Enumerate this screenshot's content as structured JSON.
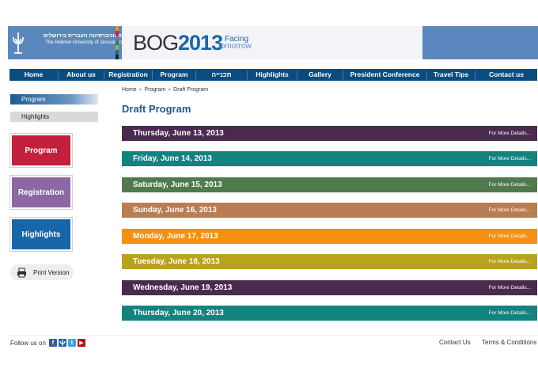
{
  "header": {
    "university_he": "האוניברסיטה העברית בירושלים",
    "university_en": "The Hebrew University of Jerusalem",
    "bog_prefix": "BOG",
    "bog_year": "2013",
    "tagline_1": "Facing",
    "tagline_2": "tomorrow",
    "brand_color": "#5a87be"
  },
  "nav": {
    "items": [
      {
        "label": "Home"
      },
      {
        "label": "About us"
      },
      {
        "label": "Registration"
      },
      {
        "label": "Program"
      },
      {
        "label": "תכנייה"
      },
      {
        "label": "Highlights"
      },
      {
        "label": "Gallery"
      },
      {
        "label": "President Conference"
      },
      {
        "label": "Travel Tips"
      },
      {
        "label": "Contact us"
      }
    ]
  },
  "sidebar": {
    "tabs": [
      {
        "label": "Program",
        "active": true
      },
      {
        "label": "Highlights",
        "active": false
      }
    ],
    "buttons": [
      {
        "label": "Program",
        "color": "#c41f3b"
      },
      {
        "label": "Registration",
        "color": "#8c67a4"
      },
      {
        "label": "Highlights",
        "color": "#1766a9"
      }
    ],
    "print_label": "Print Version",
    "print_icon": "printer-icon"
  },
  "breadcrumb": {
    "items": [
      "Home",
      "Program",
      "Draft Program"
    ],
    "separator": "»"
  },
  "main": {
    "title": "Draft Program",
    "days": [
      {
        "label": "Thursday, June 13, 2013",
        "more": "For More Details...",
        "color": "#4a2a4d"
      },
      {
        "label": "Friday, June 14, 2013",
        "more": "For More Details...",
        "color": "#12837f"
      },
      {
        "label": "Saturday, June 15, 2013",
        "more": "For More Details...",
        "color": "#4f7a4d"
      },
      {
        "label": "Sunday, June 16, 2013",
        "more": "For More Details...",
        "color": "#b87d52"
      },
      {
        "label": "Monday, June 17, 2013",
        "more": "For More Details...",
        "color": "#f59012"
      },
      {
        "label": "Tuesday, June 18, 2013",
        "more": "For More Details...",
        "color": "#b9a21e"
      },
      {
        "label": "Wednesday, June 19, 2013",
        "more": "For More Details...",
        "color": "#4a2a4d"
      },
      {
        "label": "Thursday, June 20, 2013",
        "more": "For More Details...",
        "color": "#12837f"
      }
    ]
  },
  "footer": {
    "follow_label": "Follow us on",
    "social": [
      {
        "name": "facebook-icon",
        "glyph": "f",
        "color": "#3b5998"
      },
      {
        "name": "huji-icon",
        "glyph": "",
        "color": "#1b66a8"
      },
      {
        "name": "twitter-icon",
        "glyph": "t",
        "color": "#3aa4dc"
      },
      {
        "name": "youtube-icon",
        "glyph": "▶",
        "color": "#b31217"
      }
    ],
    "contact_label": "Contact Us",
    "terms_label": "Terms & Conditions"
  }
}
